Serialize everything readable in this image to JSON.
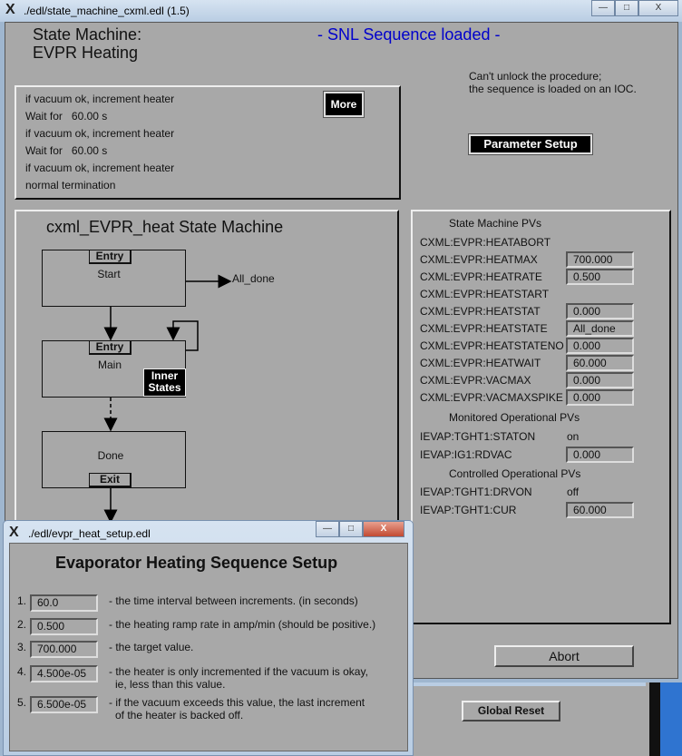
{
  "main_window": {
    "title": "./edl/state_machine_cxml.edl (1.5)",
    "controls": {
      "minimize": "—",
      "maximize": "□",
      "close": "X"
    },
    "heading_line1": "State Machine:",
    "heading_line2": "EVPR Heating",
    "status": "- SNL Sequence loaded -",
    "status_color": "#0000cc",
    "lock_message_line1": "Can't unlock the procedure;",
    "lock_message_line2": "the sequence is loaded on an IOC.",
    "parameter_setup_label": "Parameter Setup",
    "more_label": "More",
    "steps": [
      "if vacuum ok, increment heater",
      "Wait for   60.00 s",
      "if vacuum ok, increment heater",
      "Wait for   60.00 s",
      "if vacuum ok, increment heater",
      "normal termination"
    ],
    "diagram": {
      "title": "cxml_EVPR_heat State Machine",
      "states": [
        {
          "name": "Start",
          "tag": "Entry"
        },
        {
          "name": "Main",
          "tag": "Entry",
          "inner_label": "Inner States"
        },
        {
          "name": "Done",
          "tag": "Exit"
        }
      ],
      "exit_transition": "All_done"
    },
    "pvs": {
      "sm_header": "State Machine PVs",
      "sm": [
        {
          "name": "CXML:EVPR:HEATABORT",
          "value": null
        },
        {
          "name": "CXML:EVPR:HEATMAX",
          "value": "700.000"
        },
        {
          "name": "CXML:EVPR:HEATRATE",
          "value": "0.500"
        },
        {
          "name": "CXML:EVPR:HEATSTART",
          "value": null
        },
        {
          "name": "CXML:EVPR:HEATSTAT",
          "value": "0.000"
        },
        {
          "name": "CXML:EVPR:HEATSTATE",
          "value": "All_done"
        },
        {
          "name": "CXML:EVPR:HEATSTATENO",
          "value": "0.000"
        },
        {
          "name": "CXML:EVPR:HEATWAIT",
          "value": "60.000"
        },
        {
          "name": "CXML:EVPR:VACMAX",
          "value": "0.000"
        },
        {
          "name": "CXML:EVPR:VACMAXSPIKE",
          "value": "0.000"
        }
      ],
      "monitored_header": "Monitored Operational PVs",
      "monitored": [
        {
          "name": "IEVAP:TGHT1:STATON",
          "text": "on"
        },
        {
          "name": "IEVAP:IG1:RDVAC",
          "value": "0.000"
        }
      ],
      "controlled_header": "Controlled Operational PVs",
      "controlled": [
        {
          "name": "IEVAP:TGHT1:DRVON",
          "text": "off"
        },
        {
          "name": "IEVAP:TGHT1:CUR",
          "value": "60.000"
        }
      ]
    },
    "abort_label": "Abort"
  },
  "background_window": {
    "global_reset_label": "Global Reset"
  },
  "setup_window": {
    "title": "./edl/evpr_heat_setup.edl",
    "heading": "Evaporator Heating Sequence Setup",
    "params": [
      {
        "num": "1.",
        "value": "60.0",
        "desc1": "- the time interval between increments. (in seconds)",
        "desc2": ""
      },
      {
        "num": "2.",
        "value": "0.500",
        "desc1": "- the heating ramp rate in amp/min (should be positive.)",
        "desc2": ""
      },
      {
        "num": "3.",
        "value": "700.000",
        "desc1": "- the target value.",
        "desc2": ""
      },
      {
        "num": "4.",
        "value": "4.500e-05",
        "desc1": "- the heater is only incremented if the vacuum is okay,",
        "desc2": "ie, less than this value."
      },
      {
        "num": "5.",
        "value": "6.500e-05",
        "desc1": "- if the vacuum exceeds this value, the last increment",
        "desc2": "of the heater is backed off."
      }
    ]
  }
}
